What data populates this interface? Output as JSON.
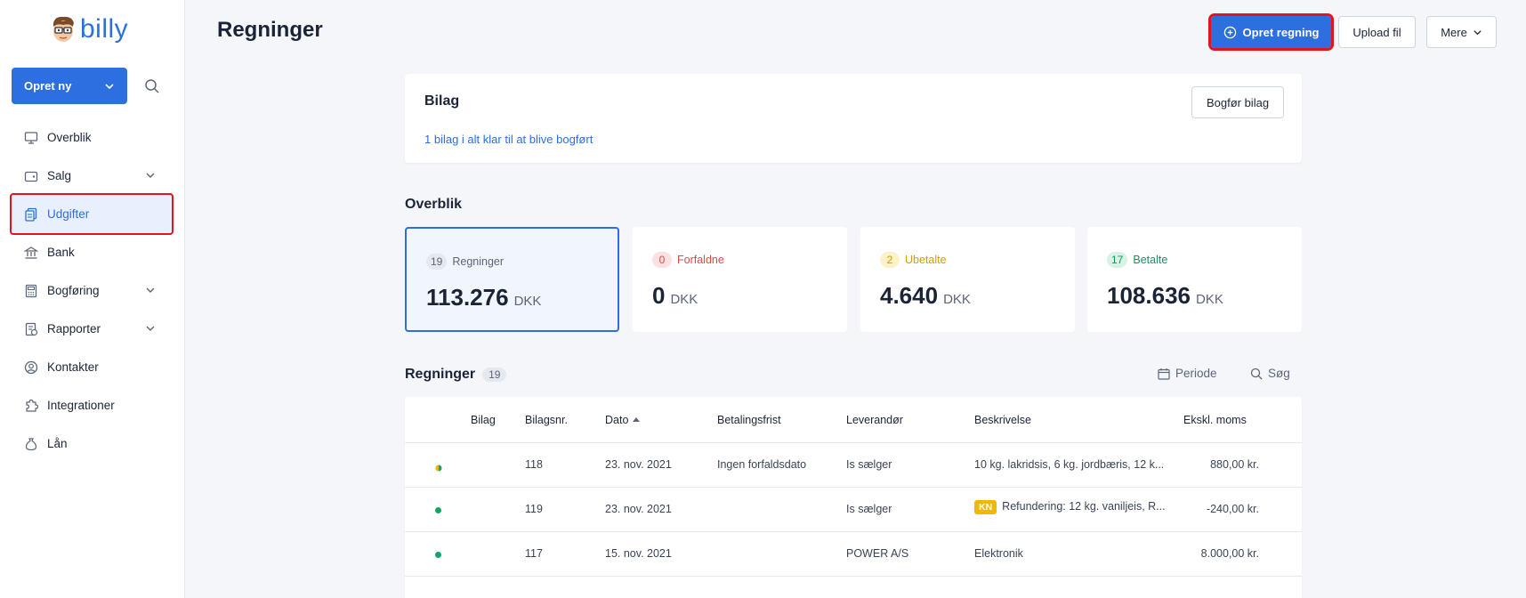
{
  "brand": {
    "name": "billy"
  },
  "sidebar": {
    "create_label": "Opret ny",
    "items": [
      {
        "label": "Overblik",
        "icon": "monitor-icon",
        "chevron": false
      },
      {
        "label": "Salg",
        "icon": "wallet-icon",
        "chevron": true
      },
      {
        "label": "Udgifter",
        "icon": "documents-icon",
        "chevron": false,
        "active": true
      },
      {
        "label": "Bank",
        "icon": "bank-icon",
        "chevron": false
      },
      {
        "label": "Bogføring",
        "icon": "calculator-icon",
        "chevron": true
      },
      {
        "label": "Rapporter",
        "icon": "report-icon",
        "chevron": true
      },
      {
        "label": "Kontakter",
        "icon": "user-circle-icon",
        "chevron": false
      },
      {
        "label": "Integrationer",
        "icon": "puzzle-icon",
        "chevron": false
      },
      {
        "label": "Lån",
        "icon": "moneybag-icon",
        "chevron": false
      }
    ]
  },
  "header": {
    "title": "Regninger",
    "primary_label": "Opret regning",
    "upload_label": "Upload fil",
    "more_label": "Mere"
  },
  "bilag": {
    "title": "Bilag",
    "link": "1 bilag i alt klar til at blive bogført",
    "button": "Bogfør bilag"
  },
  "overblik": {
    "title": "Overblik",
    "stats": [
      {
        "count": "19",
        "label": "Regninger",
        "value": "113.276",
        "currency": "DKK",
        "color": "#5c6577",
        "pill_bg": "#e5e8ee"
      },
      {
        "count": "0",
        "label": "Forfaldne",
        "value": "0",
        "currency": "DKK",
        "color": "#e04848",
        "pill_bg": "#fbe1e1"
      },
      {
        "count": "2",
        "label": "Ubetalte",
        "value": "4.640",
        "currency": "DKK",
        "color": "#d39b0a",
        "pill_bg": "#fcf1c7"
      },
      {
        "count": "17",
        "label": "Betalte",
        "value": "108.636",
        "currency": "DKK",
        "color": "#13935f",
        "pill_bg": "#d8f2e5"
      }
    ]
  },
  "regninger": {
    "title": "Regninger",
    "count": "19",
    "periode_label": "Periode",
    "search_label": "Søg",
    "columns": {
      "bilag": "Bilag",
      "bilagsnr": "Bilagsnr.",
      "dato": "Dato",
      "frist": "Betalingsfrist",
      "leverandor": "Leverandør",
      "beskrivelse": "Beskrivelse",
      "moms": "Ekskl. moms"
    },
    "rows": [
      {
        "bilagsnr": "118",
        "dato": "23. nov. 2021",
        "frist": "Ingen forfaldsdato",
        "leverandor": "Is sælger",
        "badge": "",
        "beskrivelse": "10 kg. lakridsis, 6 kg. jordbæris, 12 k...",
        "moms": "880,00 kr.",
        "status": "partial"
      },
      {
        "bilagsnr": "119",
        "dato": "23. nov. 2021",
        "frist": "",
        "leverandor": "Is sælger",
        "badge": "KN",
        "beskrivelse": "Refundering: 12 kg. vaniljeis, R...",
        "moms": "-240,00 kr.",
        "status": "paid"
      },
      {
        "bilagsnr": "117",
        "dato": "15. nov. 2021",
        "frist": "",
        "leverandor": "POWER A/S",
        "badge": "",
        "beskrivelse": "Elektronik",
        "moms": "8.000,00 kr.",
        "status": "paid"
      }
    ]
  }
}
